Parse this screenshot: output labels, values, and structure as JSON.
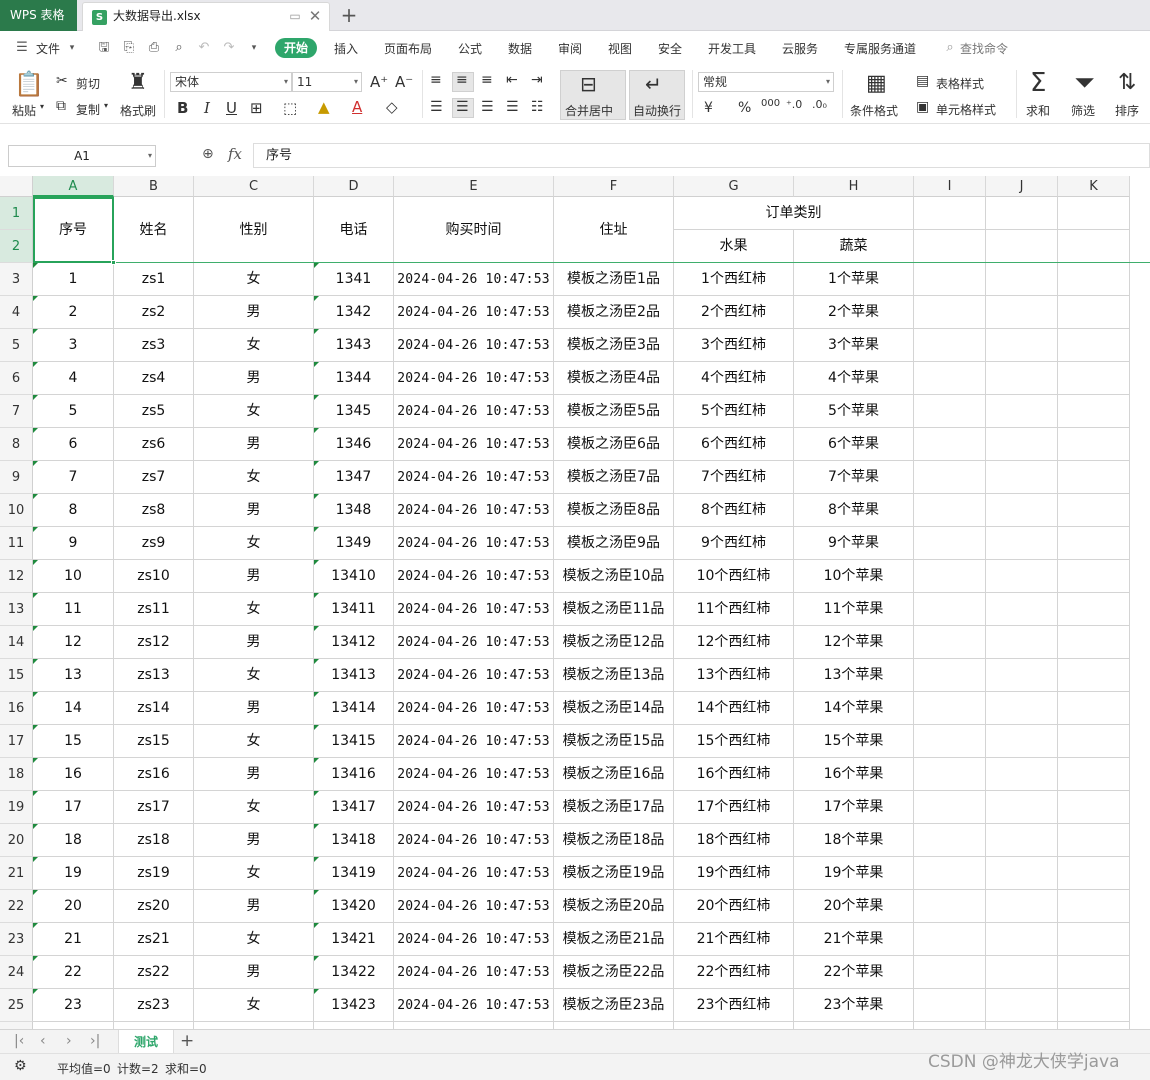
{
  "titlebar": {
    "app_name": "WPS 表格",
    "file_name": "大数据导出.xlsx",
    "file_icon_letter": "S"
  },
  "menu": {
    "file_label": "文件",
    "active_tab": "开始",
    "items": [
      "插入",
      "页面布局",
      "公式",
      "数据",
      "审阅",
      "视图",
      "安全",
      "开发工具",
      "云服务",
      "专属服务通道"
    ],
    "search_label": "查找命令"
  },
  "ribbon": {
    "paste": "粘贴",
    "cut": "剪切",
    "copy": "复制",
    "format_painter": "格式刷",
    "font_name": "宋体",
    "font_size": "11",
    "bold": "B",
    "italic": "I",
    "underline": "U",
    "merge_center": "合并居中",
    "wrap_text": "自动换行",
    "number_format": "常规",
    "currency": "¥",
    "percent": "%",
    "thousands": "000",
    "conditional_format": "条件格式",
    "table_style": "表格样式",
    "cell_style": "单元格样式",
    "sum": "求和",
    "filter": "筛选",
    "sort": "排序"
  },
  "formula_bar": {
    "cell_ref": "A1",
    "fx": "fx",
    "content": "序号"
  },
  "columns": [
    "A",
    "B",
    "C",
    "D",
    "E",
    "F",
    "G",
    "H",
    "I",
    "J",
    "K"
  ],
  "header": {
    "seq": "序号",
    "name": "姓名",
    "gender": "性别",
    "phone": "电话",
    "purchase_time": "购买时间",
    "address": "住址",
    "order_category": "订单类别",
    "fruit": "水果",
    "vegetable": "蔬菜"
  },
  "header_row_numbers": [
    "1",
    "2"
  ],
  "rows": [
    {
      "row": "3",
      "seq": "1",
      "name": "zs1",
      "gender": "女",
      "phone": "1341",
      "time": "2024-04-26 10:47:53",
      "address": "模板之汤臣1品",
      "fruit": "1个西红柿",
      "veg": "1个苹果"
    },
    {
      "row": "4",
      "seq": "2",
      "name": "zs2",
      "gender": "男",
      "phone": "1342",
      "time": "2024-04-26 10:47:53",
      "address": "模板之汤臣2品",
      "fruit": "2个西红柿",
      "veg": "2个苹果"
    },
    {
      "row": "5",
      "seq": "3",
      "name": "zs3",
      "gender": "女",
      "phone": "1343",
      "time": "2024-04-26 10:47:53",
      "address": "模板之汤臣3品",
      "fruit": "3个西红柿",
      "veg": "3个苹果"
    },
    {
      "row": "6",
      "seq": "4",
      "name": "zs4",
      "gender": "男",
      "phone": "1344",
      "time": "2024-04-26 10:47:53",
      "address": "模板之汤臣4品",
      "fruit": "4个西红柿",
      "veg": "4个苹果"
    },
    {
      "row": "7",
      "seq": "5",
      "name": "zs5",
      "gender": "女",
      "phone": "1345",
      "time": "2024-04-26 10:47:53",
      "address": "模板之汤臣5品",
      "fruit": "5个西红柿",
      "veg": "5个苹果"
    },
    {
      "row": "8",
      "seq": "6",
      "name": "zs6",
      "gender": "男",
      "phone": "1346",
      "time": "2024-04-26 10:47:53",
      "address": "模板之汤臣6品",
      "fruit": "6个西红柿",
      "veg": "6个苹果"
    },
    {
      "row": "9",
      "seq": "7",
      "name": "zs7",
      "gender": "女",
      "phone": "1347",
      "time": "2024-04-26 10:47:53",
      "address": "模板之汤臣7品",
      "fruit": "7个西红柿",
      "veg": "7个苹果"
    },
    {
      "row": "10",
      "seq": "8",
      "name": "zs8",
      "gender": "男",
      "phone": "1348",
      "time": "2024-04-26 10:47:53",
      "address": "模板之汤臣8品",
      "fruit": "8个西红柿",
      "veg": "8个苹果"
    },
    {
      "row": "11",
      "seq": "9",
      "name": "zs9",
      "gender": "女",
      "phone": "1349",
      "time": "2024-04-26 10:47:53",
      "address": "模板之汤臣9品",
      "fruit": "9个西红柿",
      "veg": "9个苹果"
    },
    {
      "row": "12",
      "seq": "10",
      "name": "zs10",
      "gender": "男",
      "phone": "13410",
      "time": "2024-04-26 10:47:53",
      "address": "模板之汤臣10品",
      "fruit": "10个西红柿",
      "veg": "10个苹果"
    },
    {
      "row": "13",
      "seq": "11",
      "name": "zs11",
      "gender": "女",
      "phone": "13411",
      "time": "2024-04-26 10:47:53",
      "address": "模板之汤臣11品",
      "fruit": "11个西红柿",
      "veg": "11个苹果"
    },
    {
      "row": "14",
      "seq": "12",
      "name": "zs12",
      "gender": "男",
      "phone": "13412",
      "time": "2024-04-26 10:47:53",
      "address": "模板之汤臣12品",
      "fruit": "12个西红柿",
      "veg": "12个苹果"
    },
    {
      "row": "15",
      "seq": "13",
      "name": "zs13",
      "gender": "女",
      "phone": "13413",
      "time": "2024-04-26 10:47:53",
      "address": "模板之汤臣13品",
      "fruit": "13个西红柿",
      "veg": "13个苹果"
    },
    {
      "row": "16",
      "seq": "14",
      "name": "zs14",
      "gender": "男",
      "phone": "13414",
      "time": "2024-04-26 10:47:53",
      "address": "模板之汤臣14品",
      "fruit": "14个西红柿",
      "veg": "14个苹果"
    },
    {
      "row": "17",
      "seq": "15",
      "name": "zs15",
      "gender": "女",
      "phone": "13415",
      "time": "2024-04-26 10:47:53",
      "address": "模板之汤臣15品",
      "fruit": "15个西红柿",
      "veg": "15个苹果"
    },
    {
      "row": "18",
      "seq": "16",
      "name": "zs16",
      "gender": "男",
      "phone": "13416",
      "time": "2024-04-26 10:47:53",
      "address": "模板之汤臣16品",
      "fruit": "16个西红柿",
      "veg": "16个苹果"
    },
    {
      "row": "19",
      "seq": "17",
      "name": "zs17",
      "gender": "女",
      "phone": "13417",
      "time": "2024-04-26 10:47:53",
      "address": "模板之汤臣17品",
      "fruit": "17个西红柿",
      "veg": "17个苹果"
    },
    {
      "row": "20",
      "seq": "18",
      "name": "zs18",
      "gender": "男",
      "phone": "13418",
      "time": "2024-04-26 10:47:53",
      "address": "模板之汤臣18品",
      "fruit": "18个西红柿",
      "veg": "18个苹果"
    },
    {
      "row": "21",
      "seq": "19",
      "name": "zs19",
      "gender": "女",
      "phone": "13419",
      "time": "2024-04-26 10:47:53",
      "address": "模板之汤臣19品",
      "fruit": "19个西红柿",
      "veg": "19个苹果"
    },
    {
      "row": "22",
      "seq": "20",
      "name": "zs20",
      "gender": "男",
      "phone": "13420",
      "time": "2024-04-26 10:47:53",
      "address": "模板之汤臣20品",
      "fruit": "20个西红柿",
      "veg": "20个苹果"
    },
    {
      "row": "23",
      "seq": "21",
      "name": "zs21",
      "gender": "女",
      "phone": "13421",
      "time": "2024-04-26 10:47:53",
      "address": "模板之汤臣21品",
      "fruit": "21个西红柿",
      "veg": "21个苹果"
    },
    {
      "row": "24",
      "seq": "22",
      "name": "zs22",
      "gender": "男",
      "phone": "13422",
      "time": "2024-04-26 10:47:53",
      "address": "模板之汤臣22品",
      "fruit": "22个西红柿",
      "veg": "22个苹果"
    },
    {
      "row": "25",
      "seq": "23",
      "name": "zs23",
      "gender": "女",
      "phone": "13423",
      "time": "2024-04-26 10:47:53",
      "address": "模板之汤臣23品",
      "fruit": "23个西红柿",
      "veg": "23个苹果"
    }
  ],
  "sheet_tab": "测试",
  "status": {
    "average": "平均值=0",
    "count": "计数=2",
    "sum": "求和=0"
  },
  "watermark": "CSDN @神龙大侠学java",
  "colors": {
    "accent": "#2ea66b",
    "app_tab": "#2b7a4b",
    "selection": "#27a35a"
  }
}
